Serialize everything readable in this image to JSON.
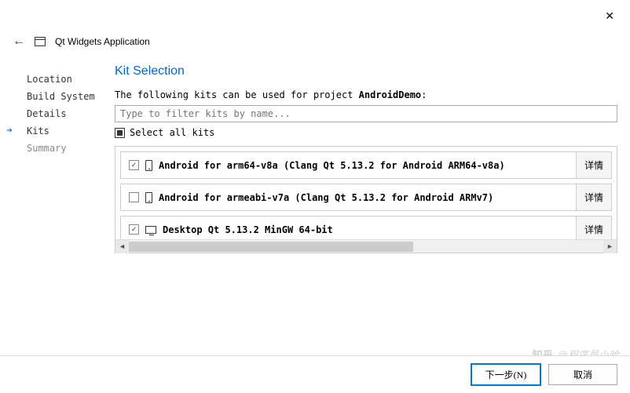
{
  "window": {
    "close_icon": "✕",
    "back_icon": "←",
    "app_title": "Qt Widgets Application"
  },
  "sidebar": {
    "items": [
      {
        "label": "Location",
        "state": "done"
      },
      {
        "label": "Build System",
        "state": "done"
      },
      {
        "label": "Details",
        "state": "done"
      },
      {
        "label": "Kits",
        "state": "active"
      },
      {
        "label": "Summary",
        "state": "pending"
      }
    ]
  },
  "main": {
    "title": "Kit Selection",
    "intro_prefix": "The following kits can be used for project ",
    "project_name": "AndroidDemo",
    "intro_suffix": ":",
    "filter_placeholder": "Type to filter kits by name...",
    "select_all_label": "Select all kits",
    "detail_label": "详情",
    "kits": [
      {
        "checked": true,
        "icon": "phone",
        "label": "Android for arm64-v8a (Clang Qt 5.13.2 for Android ARM64-v8a)"
      },
      {
        "checked": false,
        "icon": "phone",
        "label": "Android for armeabi-v7a (Clang Qt 5.13.2 for Android ARMv7)"
      },
      {
        "checked": true,
        "icon": "monitor",
        "label": "Desktop Qt 5.13.2 MinGW 64-bit"
      }
    ]
  },
  "footer": {
    "next": "下一步(N)",
    "cancel": "取消"
  },
  "watermark": {
    "logo": "知乎",
    "text": "@程序员小哈"
  }
}
